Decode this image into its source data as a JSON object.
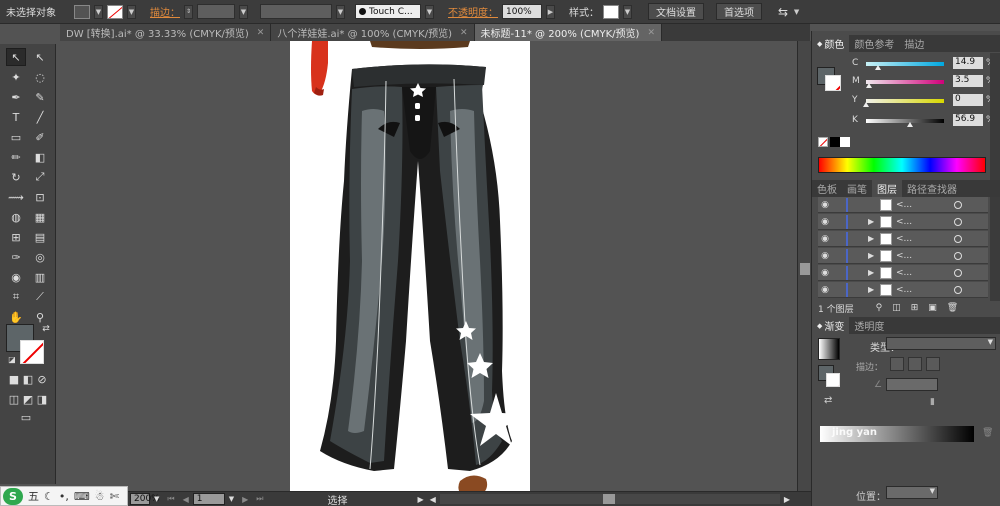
{
  "control_bar": {
    "selection": "未选择对象",
    "stroke_label": "描边：",
    "brush_name": "Touch C...",
    "opacity_label": "不透明度：",
    "opacity_value": "100%",
    "style_label": "样式：",
    "doc_setup": "文档设置",
    "preferences": "首选项"
  },
  "tabs": [
    {
      "label": "DW [转换].ai* @ 33.33% (CMYK/预览)",
      "active": false
    },
    {
      "label": "八个洋娃娃.ai* @ 100% (CMYK/预览)",
      "active": false
    },
    {
      "label": "未标题-11* @ 200% (CMYK/预览)",
      "active": true
    }
  ],
  "status": {
    "zoom": "200%",
    "page": "1",
    "tool": "选择"
  },
  "ime": {
    "label": "五"
  },
  "color_panel": {
    "tabs": [
      "颜色",
      "颜色参考",
      "描边"
    ],
    "sliders": [
      {
        "label": "C",
        "value": "14.9",
        "level": 0.149,
        "colors": [
          "#c8f0f5",
          "#00a8e0"
        ]
      },
      {
        "label": "M",
        "value": "3.5",
        "level": 0.035,
        "colors": [
          "#f0e8ee",
          "#d0007a"
        ]
      },
      {
        "label": "Y",
        "value": "0",
        "level": 0.0,
        "colors": [
          "#f0f0ea",
          "#d8d800"
        ]
      },
      {
        "label": "K",
        "value": "56.9",
        "level": 0.569,
        "colors": [
          "#ffffff",
          "#000000"
        ]
      }
    ],
    "percent": "%"
  },
  "layers_panel": {
    "tabs": [
      "色板",
      "画笔",
      "图层",
      "路径查找器"
    ],
    "rows": [
      {
        "name": "<...",
        "expandable": false
      },
      {
        "name": "<...",
        "expandable": true
      },
      {
        "name": "<...",
        "expandable": true
      },
      {
        "name": "<...",
        "expandable": true
      },
      {
        "name": "<...",
        "expandable": true
      },
      {
        "name": "<...",
        "expandable": true
      }
    ],
    "footer": "1 个图层"
  },
  "gradient_panel": {
    "tabs": [
      "渐变",
      "透明度"
    ],
    "type_label": "类型：",
    "stroke_label": "描边：",
    "position_label": "位置："
  },
  "watermark": "jing yan",
  "colors": {
    "fill": "#5d6568",
    "jeans_dark": "#1a1a1a",
    "jeans_mid": "#3e4446",
    "jeans_light": "#6b7275"
  }
}
